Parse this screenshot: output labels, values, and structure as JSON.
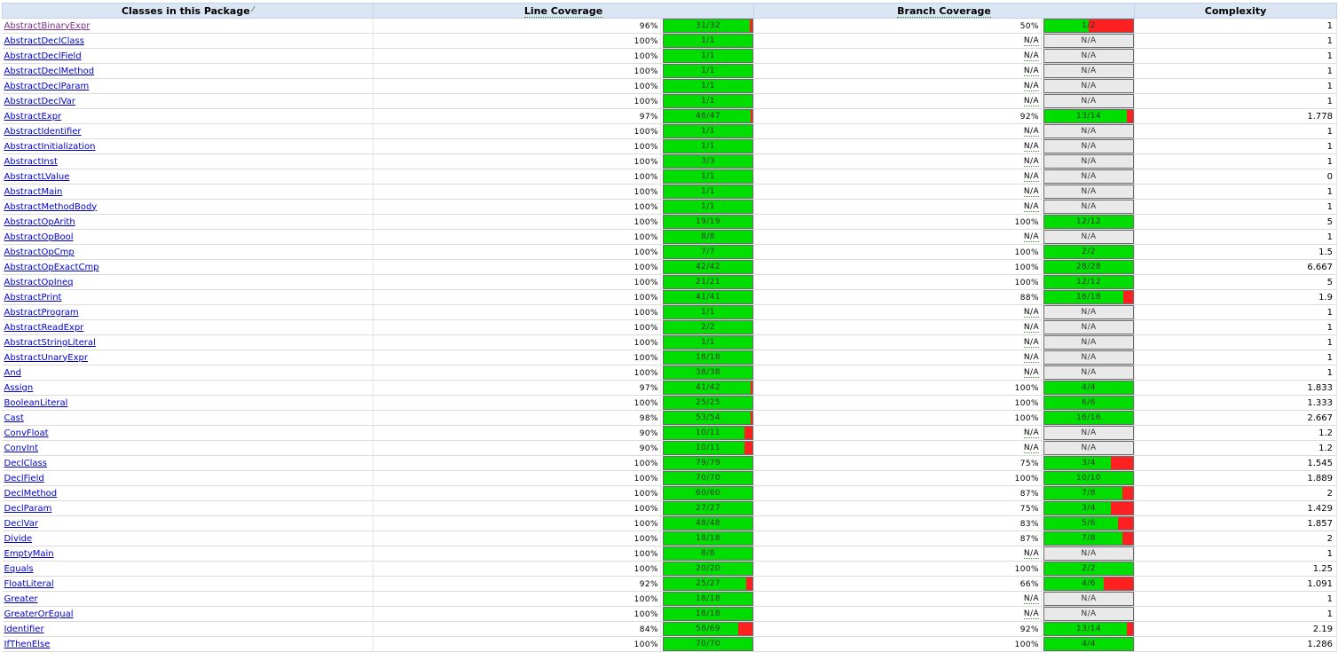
{
  "headers": {
    "classes": "Classes in this Package",
    "line": "Line Coverage",
    "branch": "Branch Coverage",
    "complexity": "Complexity"
  },
  "na_label": "N/A",
  "colors": {
    "covered": "#00dd00",
    "uncovered": "#ff2121",
    "na": "#e9e9e9",
    "header": "#dbe6f5"
  },
  "rows": [
    {
      "name": "AbstractBinaryExpr",
      "visited": true,
      "line_pct": "96%",
      "line_txt": "31/32",
      "line_frac": 0.96875,
      "branch_pct": "50%",
      "branch_txt": "1/2",
      "branch_frac": 0.5,
      "complexity": "1"
    },
    {
      "name": "AbstractDeclClass",
      "line_pct": "100%",
      "line_txt": "1/1",
      "line_frac": 1,
      "branch_pct": "N/A",
      "branch_txt": "N/A",
      "branch_frac": null,
      "complexity": "1"
    },
    {
      "name": "AbstractDeclField",
      "line_pct": "100%",
      "line_txt": "1/1",
      "line_frac": 1,
      "branch_pct": "N/A",
      "branch_txt": "N/A",
      "branch_frac": null,
      "complexity": "1"
    },
    {
      "name": "AbstractDeclMethod",
      "line_pct": "100%",
      "line_txt": "1/1",
      "line_frac": 1,
      "branch_pct": "N/A",
      "branch_txt": "N/A",
      "branch_frac": null,
      "complexity": "1"
    },
    {
      "name": "AbstractDeclParam",
      "line_pct": "100%",
      "line_txt": "1/1",
      "line_frac": 1,
      "branch_pct": "N/A",
      "branch_txt": "N/A",
      "branch_frac": null,
      "complexity": "1"
    },
    {
      "name": "AbstractDeclVar",
      "line_pct": "100%",
      "line_txt": "1/1",
      "line_frac": 1,
      "branch_pct": "N/A",
      "branch_txt": "N/A",
      "branch_frac": null,
      "complexity": "1"
    },
    {
      "name": "AbstractExpr",
      "line_pct": "97%",
      "line_txt": "46/47",
      "line_frac": 0.9787,
      "branch_pct": "92%",
      "branch_txt": "13/14",
      "branch_frac": 0.9286,
      "complexity": "1.778"
    },
    {
      "name": "AbstractIdentifier",
      "line_pct": "100%",
      "line_txt": "1/1",
      "line_frac": 1,
      "branch_pct": "N/A",
      "branch_txt": "N/A",
      "branch_frac": null,
      "complexity": "1"
    },
    {
      "name": "AbstractInitialization",
      "line_pct": "100%",
      "line_txt": "1/1",
      "line_frac": 1,
      "branch_pct": "N/A",
      "branch_txt": "N/A",
      "branch_frac": null,
      "complexity": "1"
    },
    {
      "name": "AbstractInst",
      "line_pct": "100%",
      "line_txt": "3/3",
      "line_frac": 1,
      "branch_pct": "N/A",
      "branch_txt": "N/A",
      "branch_frac": null,
      "complexity": "1"
    },
    {
      "name": "AbstractLValue",
      "line_pct": "100%",
      "line_txt": "1/1",
      "line_frac": 1,
      "branch_pct": "N/A",
      "branch_txt": "N/A",
      "branch_frac": null,
      "complexity": "0"
    },
    {
      "name": "AbstractMain",
      "line_pct": "100%",
      "line_txt": "1/1",
      "line_frac": 1,
      "branch_pct": "N/A",
      "branch_txt": "N/A",
      "branch_frac": null,
      "complexity": "1"
    },
    {
      "name": "AbstractMethodBody",
      "line_pct": "100%",
      "line_txt": "1/1",
      "line_frac": 1,
      "branch_pct": "N/A",
      "branch_txt": "N/A",
      "branch_frac": null,
      "complexity": "1"
    },
    {
      "name": "AbstractOpArith",
      "line_pct": "100%",
      "line_txt": "19/19",
      "line_frac": 1,
      "branch_pct": "100%",
      "branch_txt": "12/12",
      "branch_frac": 1,
      "complexity": "5"
    },
    {
      "name": "AbstractOpBool",
      "line_pct": "100%",
      "line_txt": "8/8",
      "line_frac": 1,
      "branch_pct": "N/A",
      "branch_txt": "N/A",
      "branch_frac": null,
      "complexity": "1"
    },
    {
      "name": "AbstractOpCmp",
      "line_pct": "100%",
      "line_txt": "7/7",
      "line_frac": 1,
      "branch_pct": "100%",
      "branch_txt": "2/2",
      "branch_frac": 1,
      "complexity": "1.5"
    },
    {
      "name": "AbstractOpExactCmp",
      "line_pct": "100%",
      "line_txt": "42/42",
      "line_frac": 1,
      "branch_pct": "100%",
      "branch_txt": "28/28",
      "branch_frac": 1,
      "complexity": "6.667"
    },
    {
      "name": "AbstractOpIneq",
      "line_pct": "100%",
      "line_txt": "21/21",
      "line_frac": 1,
      "branch_pct": "100%",
      "branch_txt": "12/12",
      "branch_frac": 1,
      "complexity": "5"
    },
    {
      "name": "AbstractPrint",
      "line_pct": "100%",
      "line_txt": "41/41",
      "line_frac": 1,
      "branch_pct": "88%",
      "branch_txt": "16/18",
      "branch_frac": 0.8889,
      "complexity": "1.9"
    },
    {
      "name": "AbstractProgram",
      "line_pct": "100%",
      "line_txt": "1/1",
      "line_frac": 1,
      "branch_pct": "N/A",
      "branch_txt": "N/A",
      "branch_frac": null,
      "complexity": "1"
    },
    {
      "name": "AbstractReadExpr",
      "line_pct": "100%",
      "line_txt": "2/2",
      "line_frac": 1,
      "branch_pct": "N/A",
      "branch_txt": "N/A",
      "branch_frac": null,
      "complexity": "1"
    },
    {
      "name": "AbstractStringLiteral",
      "line_pct": "100%",
      "line_txt": "1/1",
      "line_frac": 1,
      "branch_pct": "N/A",
      "branch_txt": "N/A",
      "branch_frac": null,
      "complexity": "1"
    },
    {
      "name": "AbstractUnaryExpr",
      "line_pct": "100%",
      "line_txt": "18/18",
      "line_frac": 1,
      "branch_pct": "N/A",
      "branch_txt": "N/A",
      "branch_frac": null,
      "complexity": "1"
    },
    {
      "name": "And",
      "line_pct": "100%",
      "line_txt": "38/38",
      "line_frac": 1,
      "branch_pct": "N/A",
      "branch_txt": "N/A",
      "branch_frac": null,
      "complexity": "1"
    },
    {
      "name": "Assign",
      "line_pct": "97%",
      "line_txt": "41/42",
      "line_frac": 0.9762,
      "branch_pct": "100%",
      "branch_txt": "4/4",
      "branch_frac": 1,
      "complexity": "1.833"
    },
    {
      "name": "BooleanLiteral",
      "line_pct": "100%",
      "line_txt": "25/25",
      "line_frac": 1,
      "branch_pct": "100%",
      "branch_txt": "6/6",
      "branch_frac": 1,
      "complexity": "1.333"
    },
    {
      "name": "Cast",
      "line_pct": "98%",
      "line_txt": "53/54",
      "line_frac": 0.9815,
      "branch_pct": "100%",
      "branch_txt": "16/16",
      "branch_frac": 1,
      "complexity": "2.667"
    },
    {
      "name": "ConvFloat",
      "line_pct": "90%",
      "line_txt": "10/11",
      "line_frac": 0.9091,
      "branch_pct": "N/A",
      "branch_txt": "N/A",
      "branch_frac": null,
      "complexity": "1.2"
    },
    {
      "name": "ConvInt",
      "line_pct": "90%",
      "line_txt": "10/11",
      "line_frac": 0.9091,
      "branch_pct": "N/A",
      "branch_txt": "N/A",
      "branch_frac": null,
      "complexity": "1.2"
    },
    {
      "name": "DeclClass",
      "line_pct": "100%",
      "line_txt": "79/79",
      "line_frac": 1,
      "branch_pct": "75%",
      "branch_txt": "3/4",
      "branch_frac": 0.75,
      "complexity": "1.545"
    },
    {
      "name": "DeclField",
      "line_pct": "100%",
      "line_txt": "70/70",
      "line_frac": 1,
      "branch_pct": "100%",
      "branch_txt": "10/10",
      "branch_frac": 1,
      "complexity": "1.889"
    },
    {
      "name": "DeclMethod",
      "line_pct": "100%",
      "line_txt": "60/60",
      "line_frac": 1,
      "branch_pct": "87%",
      "branch_txt": "7/8",
      "branch_frac": 0.875,
      "complexity": "2"
    },
    {
      "name": "DeclParam",
      "line_pct": "100%",
      "line_txt": "27/27",
      "line_frac": 1,
      "branch_pct": "75%",
      "branch_txt": "3/4",
      "branch_frac": 0.75,
      "complexity": "1.429"
    },
    {
      "name": "DeclVar",
      "line_pct": "100%",
      "line_txt": "48/48",
      "line_frac": 1,
      "branch_pct": "83%",
      "branch_txt": "5/6",
      "branch_frac": 0.8333,
      "complexity": "1.857"
    },
    {
      "name": "Divide",
      "line_pct": "100%",
      "line_txt": "18/18",
      "line_frac": 1,
      "branch_pct": "87%",
      "branch_txt": "7/8",
      "branch_frac": 0.875,
      "complexity": "2"
    },
    {
      "name": "EmptyMain",
      "line_pct": "100%",
      "line_txt": "8/8",
      "line_frac": 1,
      "branch_pct": "N/A",
      "branch_txt": "N/A",
      "branch_frac": null,
      "complexity": "1"
    },
    {
      "name": "Equals",
      "line_pct": "100%",
      "line_txt": "20/20",
      "line_frac": 1,
      "branch_pct": "100%",
      "branch_txt": "2/2",
      "branch_frac": 1,
      "complexity": "1.25"
    },
    {
      "name": "FloatLiteral",
      "line_pct": "92%",
      "line_txt": "25/27",
      "line_frac": 0.9259,
      "branch_pct": "66%",
      "branch_txt": "4/6",
      "branch_frac": 0.6667,
      "complexity": "1.091"
    },
    {
      "name": "Greater",
      "line_pct": "100%",
      "line_txt": "18/18",
      "line_frac": 1,
      "branch_pct": "N/A",
      "branch_txt": "N/A",
      "branch_frac": null,
      "complexity": "1"
    },
    {
      "name": "GreaterOrEqual",
      "line_pct": "100%",
      "line_txt": "18/18",
      "line_frac": 1,
      "branch_pct": "N/A",
      "branch_txt": "N/A",
      "branch_frac": null,
      "complexity": "1"
    },
    {
      "name": "Identifier",
      "line_pct": "84%",
      "line_txt": "58/69",
      "line_frac": 0.8406,
      "branch_pct": "92%",
      "branch_txt": "13/14",
      "branch_frac": 0.9286,
      "complexity": "2.19"
    },
    {
      "name": "IfThenElse",
      "line_pct": "100%",
      "line_txt": "70/70",
      "line_frac": 1,
      "branch_pct": "100%",
      "branch_txt": "4/4",
      "branch_frac": 1,
      "complexity": "1.286"
    }
  ]
}
